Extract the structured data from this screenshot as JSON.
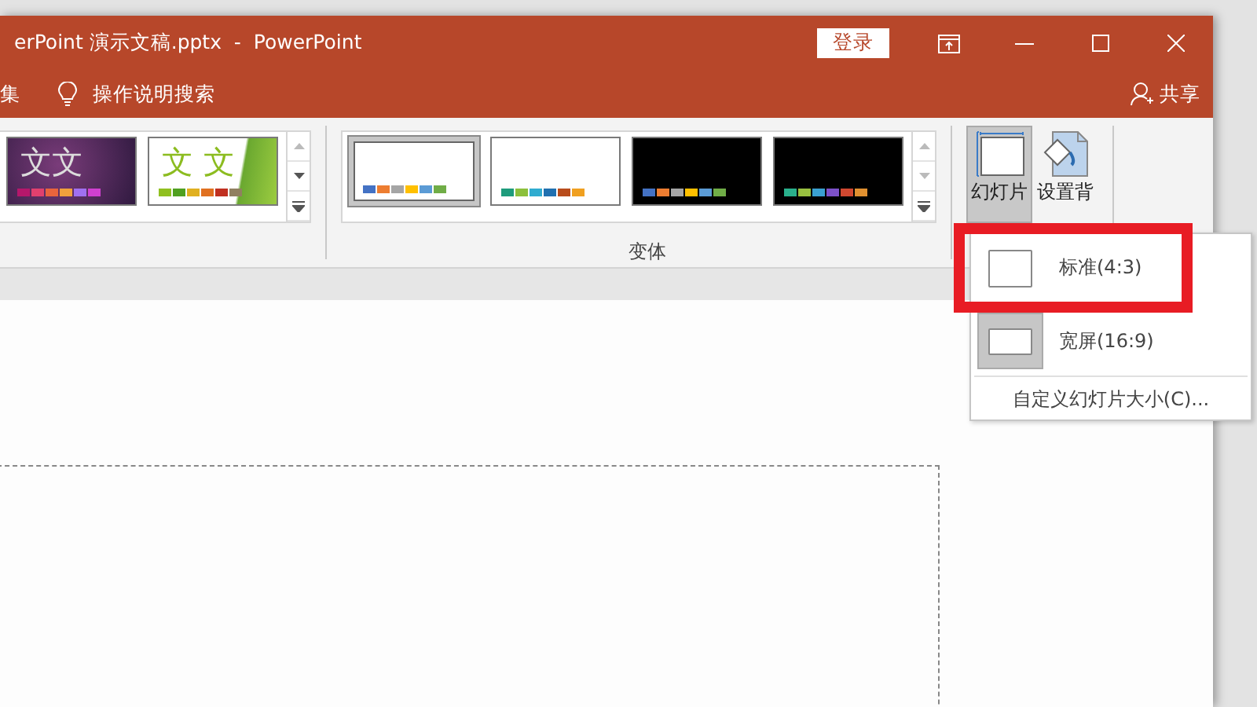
{
  "window": {
    "title": "erPoint 演示文稿.pptx  -  PowerPoint",
    "login_button": "登录"
  },
  "ribbon_tabs": {
    "cut_tab": "集",
    "search": "操作说明搜索",
    "share": "共享"
  },
  "themes": [
    {
      "kind": "purple",
      "text": "文文",
      "swatches": [
        {
          "color": "#b5176b"
        },
        {
          "color": "#e0406e"
        },
        {
          "color": "#e8643c"
        },
        {
          "color": "#f0a03c"
        },
        {
          "color": "#a070f0"
        },
        {
          "color": "#d040d0"
        }
      ]
    },
    {
      "kind": "green",
      "text": "文 文",
      "swatches": [
        {
          "color": "#90c020"
        },
        {
          "color": "#50a020"
        },
        {
          "color": "#e0b020"
        },
        {
          "color": "#e07020"
        },
        {
          "color": "#c03020"
        },
        {
          "color": "#908060"
        }
      ]
    }
  ],
  "variants": {
    "label": "变体",
    "items": [
      {
        "kind": "light",
        "selected": true,
        "swatches": [
          {
            "color": "#4472c4"
          },
          {
            "color": "#ed7d31"
          },
          {
            "color": "#a5a5a5"
          },
          {
            "color": "#ffc000"
          },
          {
            "color": "#5b9bd5"
          },
          {
            "color": "#70ad47"
          }
        ]
      },
      {
        "kind": "light",
        "selected": false,
        "swatches": [
          {
            "color": "#1e9c7c"
          },
          {
            "color": "#8cc03c"
          },
          {
            "color": "#30acd0"
          },
          {
            "color": "#2070b0"
          },
          {
            "color": "#b84c1c"
          },
          {
            "color": "#f0a020"
          }
        ]
      },
      {
        "kind": "dark",
        "selected": false,
        "swatches": [
          {
            "color": "#4472c4"
          },
          {
            "color": "#ed7d31"
          },
          {
            "color": "#a5a5a5"
          },
          {
            "color": "#ffc000"
          },
          {
            "color": "#5b9bd5"
          },
          {
            "color": "#70ad47"
          }
        ]
      },
      {
        "kind": "dark",
        "selected": false,
        "swatches": [
          {
            "color": "#2ab08c"
          },
          {
            "color": "#98c040"
          },
          {
            "color": "#3aa0d0"
          },
          {
            "color": "#7c50c8"
          },
          {
            "color": "#d04830"
          },
          {
            "color": "#e09030"
          }
        ]
      }
    ]
  },
  "slide_size_button": {
    "lines": [
      "幻灯片"
    ],
    "expanded": true
  },
  "background_button": {
    "lines": [
      "设置背"
    ]
  },
  "size_menu": {
    "items": [
      {
        "label": "标准(4:3)",
        "kind": "standard",
        "selected": false
      },
      {
        "label": "宽屏(16:9)",
        "kind": "wide",
        "selected": true
      }
    ],
    "custom": "自定义幻灯片大小(C)..."
  }
}
